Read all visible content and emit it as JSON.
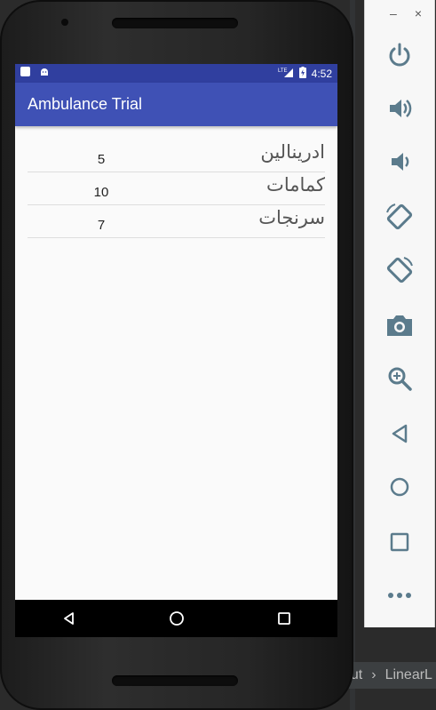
{
  "app": {
    "title": "Ambulance Trial"
  },
  "status_bar": {
    "network": "LTE",
    "time": "4:52"
  },
  "items": [
    {
      "name": "ادرينالين",
      "qty": "5"
    },
    {
      "name": "كمامات",
      "qty": "10"
    },
    {
      "name": "سرنجات",
      "qty": "7"
    }
  ],
  "emulator_panel": {
    "window_controls": {
      "minimize": "–",
      "close": "×"
    },
    "controls": [
      "power-icon",
      "volume-up-icon",
      "volume-down-icon",
      "rotate-left-icon",
      "rotate-right-icon",
      "camera-icon",
      "zoom-icon",
      "back-icon",
      "home-icon",
      "overview-icon",
      "more-icon"
    ]
  },
  "ide": {
    "breadcrumb_1": "out",
    "breadcrumb_2": "LinearL"
  },
  "colors": {
    "primary": "#3f51b5",
    "primary_dark": "#303f9f",
    "icon": "#5b7b8c"
  }
}
